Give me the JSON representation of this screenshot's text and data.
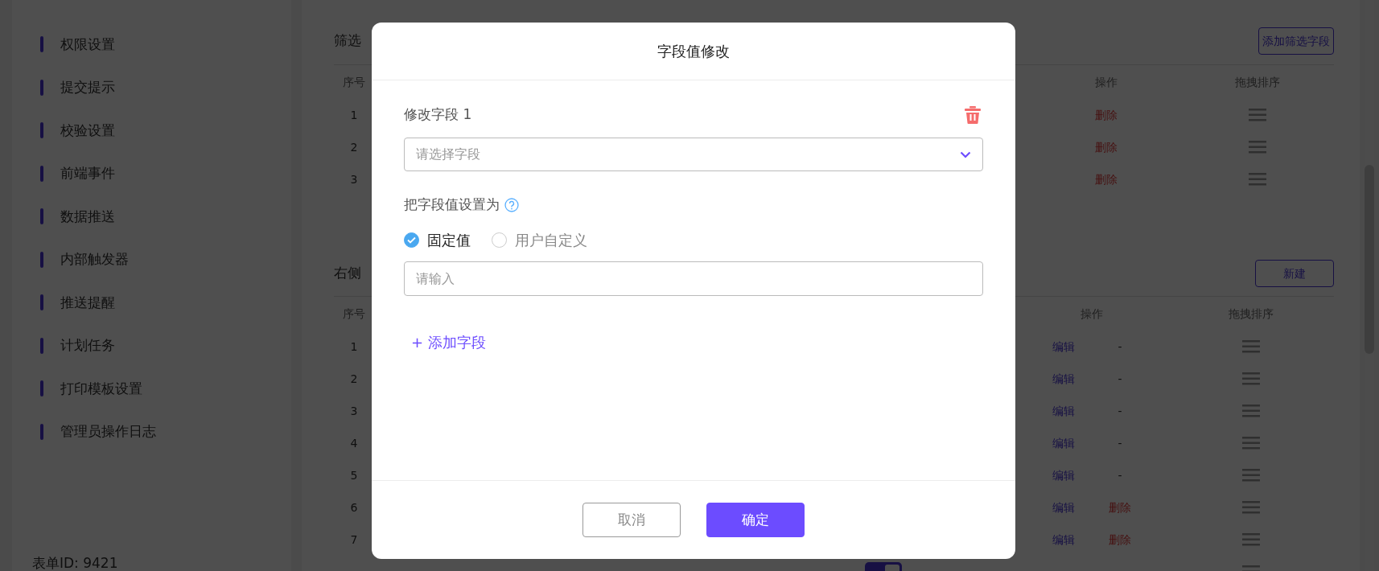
{
  "sidebar": {
    "items": [
      {
        "label": "权限设置"
      },
      {
        "label": "提交提示"
      },
      {
        "label": "校验设置"
      },
      {
        "label": "前端事件"
      },
      {
        "label": "数据推送"
      },
      {
        "label": "内部触发器"
      },
      {
        "label": "推送提醒"
      },
      {
        "label": "计划任务"
      },
      {
        "label": "打印模板设置"
      },
      {
        "label": "管理员操作日志"
      }
    ],
    "form_id": "表单ID: 9421"
  },
  "filter_section": {
    "title": "筛选",
    "add_button": "添加筛选字段",
    "columns": [
      "序号",
      "操作",
      "拖拽排序"
    ],
    "rows": [
      {
        "index": "1",
        "action": "删除"
      },
      {
        "index": "2",
        "action": "删除"
      },
      {
        "index": "3",
        "action": "删除"
      }
    ]
  },
  "right_section": {
    "title": "右侧",
    "new_button": "新建",
    "columns": [
      "序号",
      "操作",
      "拖拽排序"
    ],
    "rows": [
      {
        "index": "1",
        "edit": "编辑",
        "action": "-"
      },
      {
        "index": "2",
        "edit": "编辑",
        "action": "-"
      },
      {
        "index": "3",
        "edit": "编辑",
        "action": "-"
      },
      {
        "index": "4",
        "edit": "编辑",
        "action": "-"
      },
      {
        "index": "5",
        "edit": "编辑",
        "action": "-"
      },
      {
        "index": "6",
        "edit": "编辑",
        "action": "删除"
      },
      {
        "index": "7",
        "edit": "编辑",
        "action": "删除"
      },
      {
        "on": true
      }
    ]
  },
  "modal": {
    "title": "字段值修改",
    "fields": [
      {
        "label": "修改字段 1",
        "placeholder": "请选择字段"
      }
    ],
    "value_label": "把字段值设置为",
    "value_options": [
      {
        "label": "固定值",
        "selected": true
      },
      {
        "label": "用户自定义",
        "selected": false
      }
    ],
    "value_placeholder": "请输入",
    "add_field": "+ 添加字段",
    "buttons": [
      {
        "label": "取消",
        "kind": "secondary"
      },
      {
        "label": "确定",
        "kind": "primary"
      }
    ]
  }
}
